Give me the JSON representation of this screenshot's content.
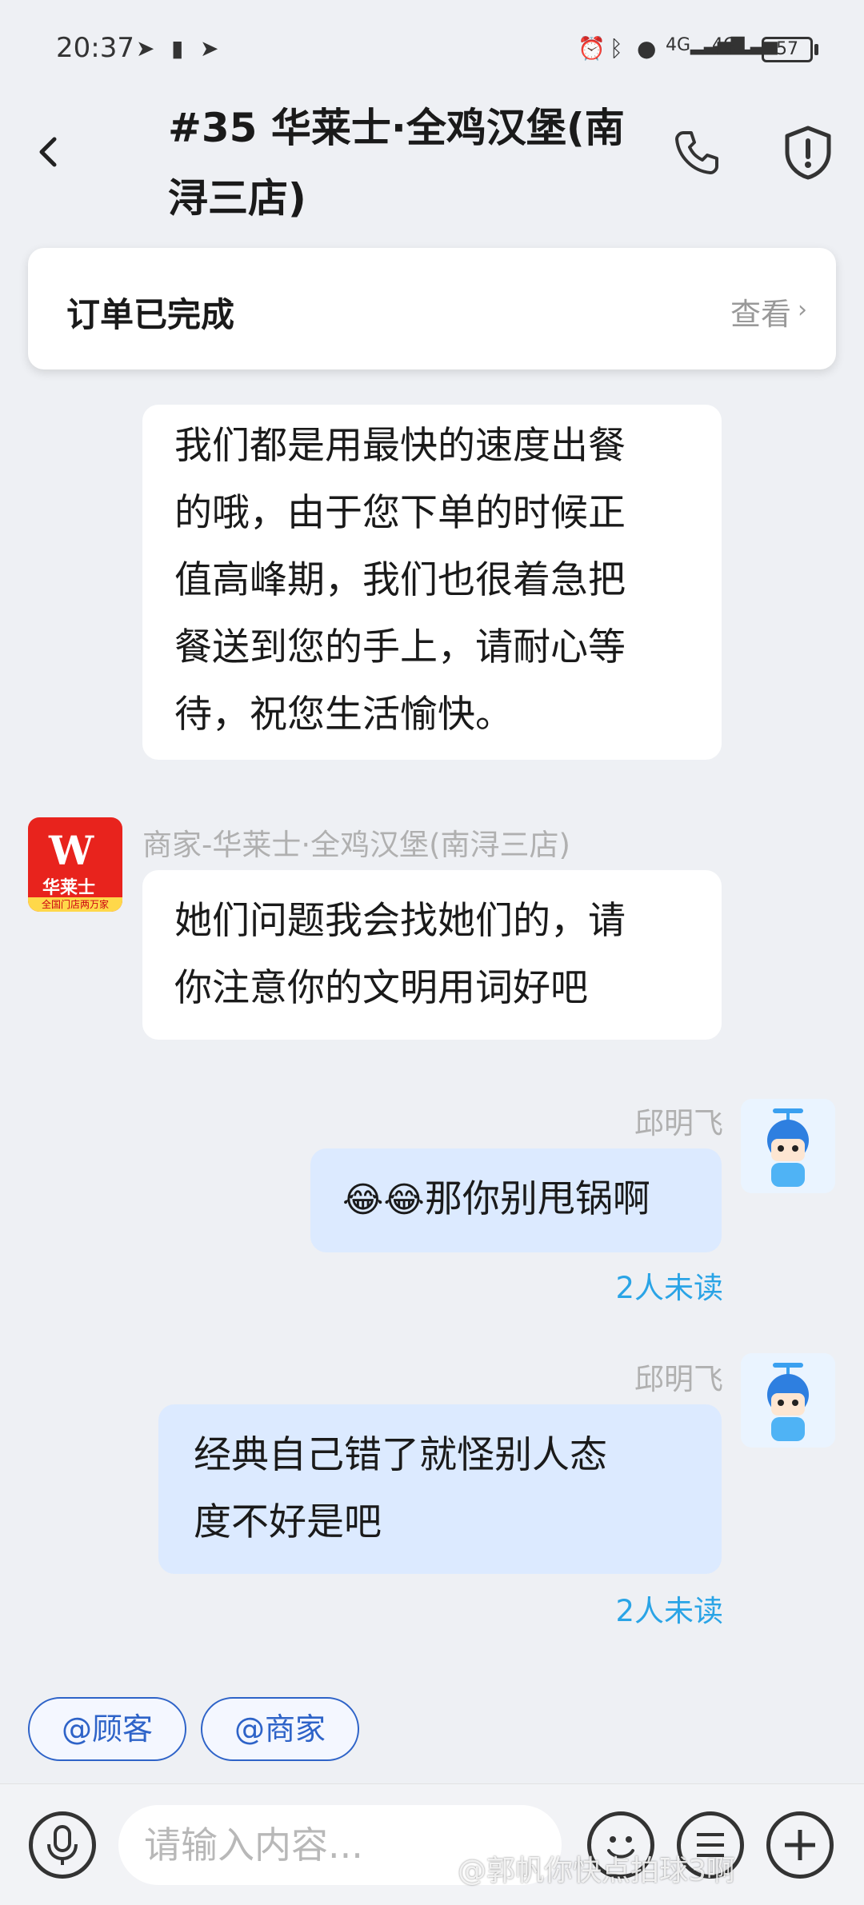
{
  "status_bar": {
    "time": "20:37",
    "battery": "57"
  },
  "header": {
    "title": "#35 华莱士·全鸡汉堡(南浔三店)",
    "back_icon": "chevron-left-icon",
    "phone_icon": "phone-icon",
    "shield_icon": "shield-icon"
  },
  "order_card": {
    "status": "订单已完成",
    "view_label": "查看"
  },
  "messages": [
    {
      "text": "我们都是用最快的速度出餐\n的哦，由于您下单的时候正\n值高峰期，我们也很着急把\n餐送到您的手上，请耐心等\n待，祝您生活愉快。"
    },
    {
      "sender": "商家-华莱士·全鸡汉堡(南浔三店)",
      "text": "她们问题我会找她们的，请\n你注意你的文明用词好吧",
      "avatar_brand": "华莱士",
      "avatar_tagline": "全国门店两万家"
    },
    {
      "sender": "邱明飞",
      "emoji": "😂😂",
      "text": "那你别甩锅啊",
      "read_status": "2人未读"
    },
    {
      "sender": "邱明飞",
      "text": "经典自己错了就怪别人态\n度不好是吧",
      "read_status": "2人未读"
    }
  ],
  "quick_mentions": [
    "@顾客",
    "@商家"
  ],
  "input": {
    "placeholder": "请输入内容..."
  },
  "bottom_icons": [
    "microphone-icon",
    "emoji-icon",
    "list-icon",
    "plus-icon"
  ],
  "watermark": "@郭帆你快点拍球3啊"
}
